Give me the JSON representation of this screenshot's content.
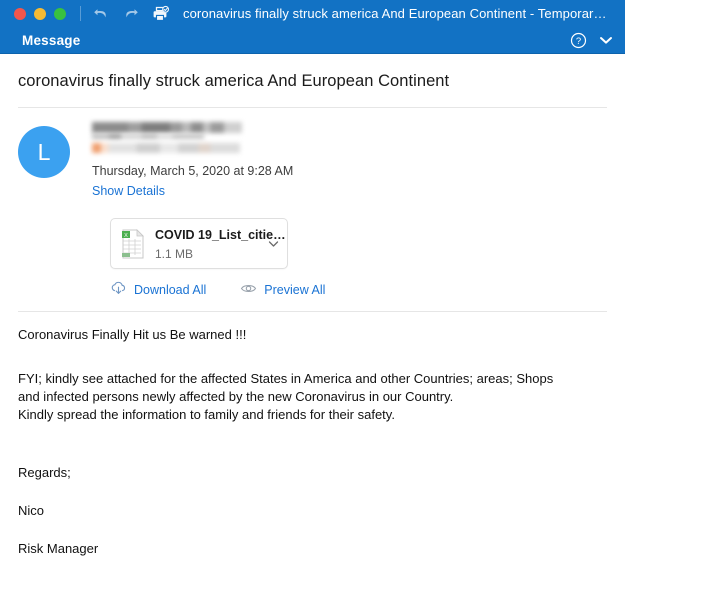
{
  "window": {
    "title": "coronavirus finally struck america And European Continent - Temporary…",
    "traffic_lights": [
      "close-button",
      "minimize-button",
      "zoom-button"
    ],
    "toolbar_icons": [
      "undo-icon",
      "redo-icon",
      "print-icon"
    ],
    "ribbon_tab": "Message",
    "help_icon": "help-circle-icon",
    "chevron_icon": "chevron-down-icon"
  },
  "message": {
    "subject": "coronavirus finally struck america And European Continent",
    "avatar_initial": "L",
    "sender_redacted": true,
    "date": "Thursday, March 5, 2020 at 9:28 AM",
    "show_details": "Show Details"
  },
  "attachment": {
    "icon": "excel-file-icon",
    "name": "COVID 19_List_citie…",
    "size": "1.1 MB",
    "chevron": "chevron-down-icon",
    "download_all": "Download All",
    "download_icon": "cloud-download-icon",
    "preview_all": "Preview All",
    "preview_icon": "eye-icon"
  },
  "body": {
    "line1": "Coronavirus Finally Hit us Be warned !!!",
    "line2": "FYI; kindly see attached for the affected States in America and other Countries; areas; Shops",
    "line3": "and infected persons newly affected by the new Coronavirus in our Country.",
    "line4": "Kindly spread the information to family and friends for their safety.",
    "sign_off": "Regards;",
    "sender_name": "Nico",
    "sender_title": "Risk Manager"
  },
  "colors": {
    "titlebar_blue": "#1272c4",
    "link_blue": "#1a73d4",
    "avatar_blue": "#3ba1f0",
    "excel_green": "#4caf50"
  }
}
